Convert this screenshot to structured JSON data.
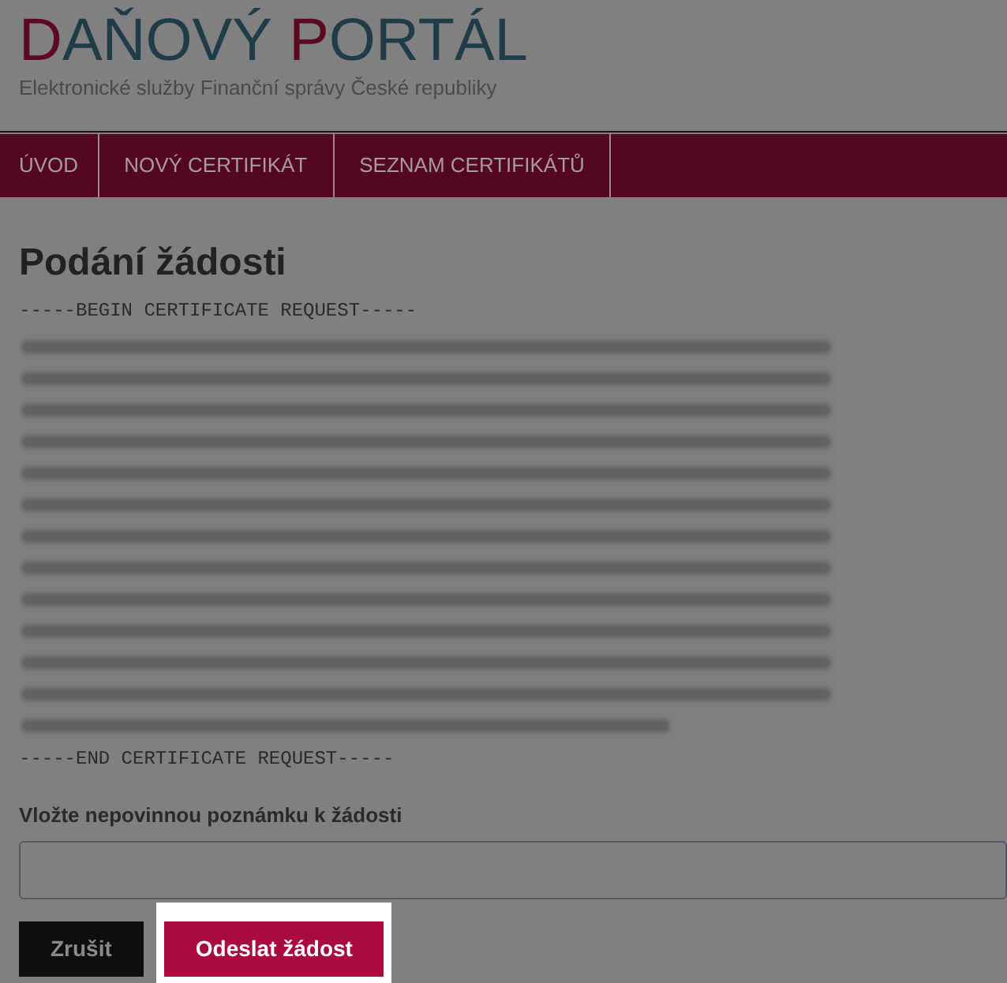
{
  "header": {
    "title_parts": [
      {
        "text": "D",
        "accent": true
      },
      {
        "text": "AŇOVÝ ",
        "accent": false
      },
      {
        "text": "P",
        "accent": true
      },
      {
        "text": "ORTÁL",
        "accent": false
      }
    ],
    "subtitle": "Elektronické služby Finanční správy České republiky"
  },
  "nav": [
    {
      "label": "ÚVOD"
    },
    {
      "label": "NOVÝ CERTIFIKÁT"
    },
    {
      "label": "SEZNAM CERTIFIKÁTŮ"
    }
  ],
  "heading": "Podání žádosti",
  "certificate": {
    "begin": "-----BEGIN CERTIFICATE REQUEST-----",
    "end": "-----END CERTIFICATE REQUEST-----"
  },
  "note": {
    "label": "Vložte nepovinnou poznámku k žádosti"
  },
  "buttons": [
    {
      "label": "Zrušit",
      "kind": "cancel",
      "highlighted": false
    },
    {
      "label": "Odeslat žádost",
      "kind": "submit",
      "highlighted": true
    }
  ]
}
